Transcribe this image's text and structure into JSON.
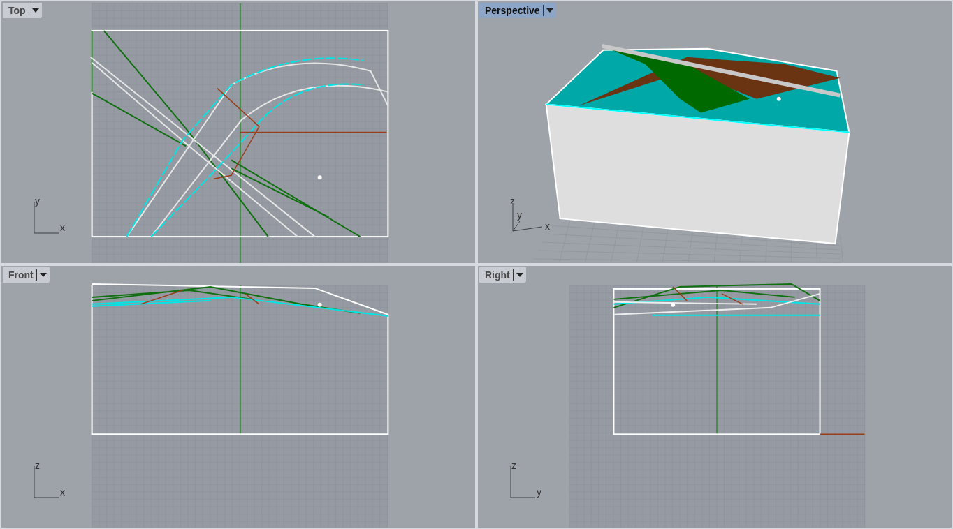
{
  "viewports": [
    {
      "title": "Top",
      "kind": "top",
      "selected": false,
      "axes": [
        "y",
        "x"
      ]
    },
    {
      "title": "Perspective",
      "kind": "perspective",
      "selected": true,
      "axes": [
        "z",
        "y",
        "x"
      ]
    },
    {
      "title": "Front",
      "kind": "front",
      "selected": false,
      "axes": [
        "z",
        "x"
      ]
    },
    {
      "title": "Right",
      "kind": "right",
      "selected": false,
      "axes": [
        "z",
        "y"
      ]
    }
  ]
}
